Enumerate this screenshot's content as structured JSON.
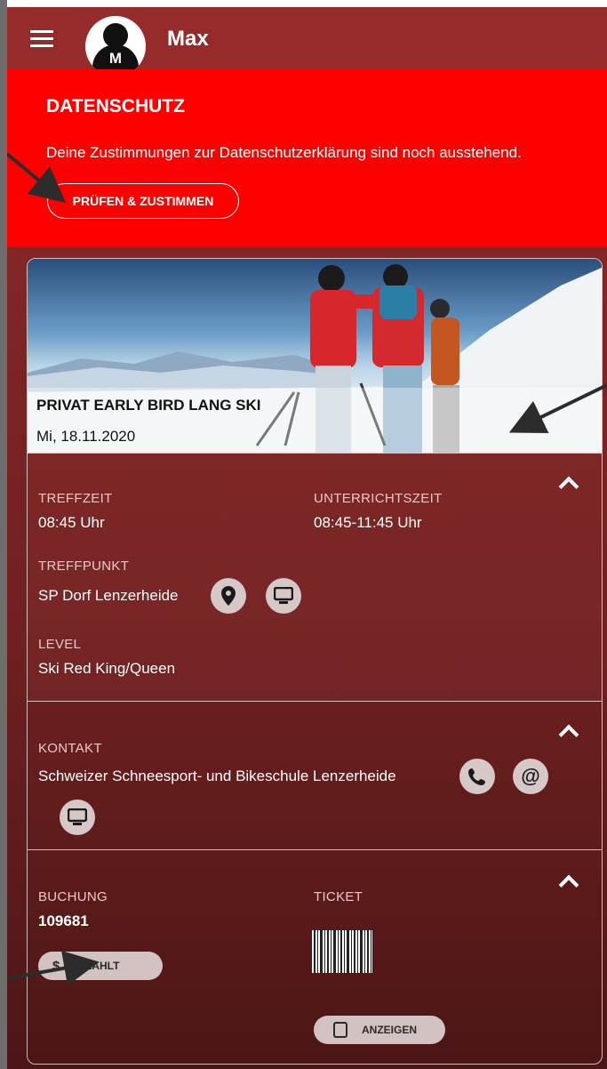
{
  "header": {
    "username": "Max",
    "avatar_letter": "M"
  },
  "privacy": {
    "title": "DATENSCHUTZ",
    "message": "Deine Zustimmungen zur Datenschutzerklärung sind noch ausstehend.",
    "button_label": "PRÜFEN & ZUSTIMMEN"
  },
  "course": {
    "title": "PRIVAT EARLY BIRD LANG SKI",
    "date": "Mi, 18.11.2020",
    "details": {
      "meeting_time_label": "TREFFZEIT",
      "meeting_time": "08:45 Uhr",
      "lesson_time_label": "UNTERRICHTSZEIT",
      "lesson_time": "08:45-11:45 Uhr",
      "meeting_point_label": "TREFFPUNKT",
      "meeting_point": "SP Dorf Lenzerheide",
      "level_label": "LEVEL",
      "level": "Ski Red King/Queen"
    },
    "contact": {
      "label": "KONTAKT",
      "name": "Schweizer Schneesport- und Bikeschule Lenzerheide"
    },
    "booking": {
      "label": "BUCHUNG",
      "number": "109681",
      "status_label": "BEZAHLT",
      "ticket_label": "TICKET",
      "show_button_label": "ANZEIGEN"
    }
  },
  "icons": {
    "menu": "hamburger-menu-icon",
    "location": "location-pin-icon",
    "web": "monitor-icon",
    "phone": "phone-icon",
    "email": "at-icon",
    "chevron": "chevron-up-icon",
    "ticket": "barcode-icon"
  },
  "colors": {
    "banner": "#ff0000",
    "header": "#952b2b",
    "card_bg": "#7a2424"
  }
}
